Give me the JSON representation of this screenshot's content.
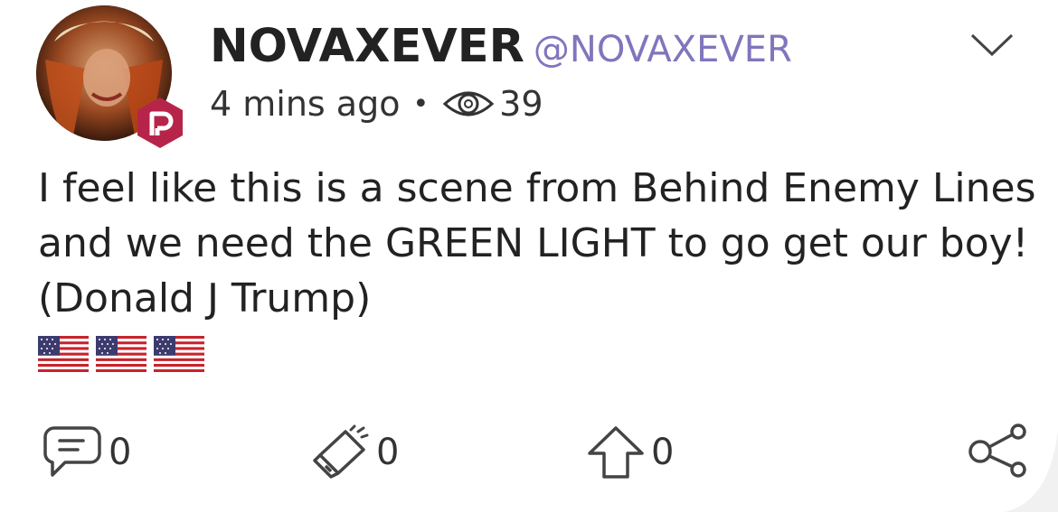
{
  "post": {
    "display_name": "NOVAXEVER",
    "handle": "@NOVAXEVER",
    "time_ago": "4 mins ago",
    "separator": "•",
    "views": "39",
    "text": "I feel like this is a scene from Behind Enemy Lines and we need the GREEN LIGHT to go get our boy! (Donald J Trump)",
    "emoji": [
      "us-flag",
      "us-flag",
      "us-flag"
    ]
  },
  "actions": {
    "comments": "0",
    "echoes": "0",
    "upvotes": "0"
  },
  "icons": {
    "badge": "parler-p-badge-icon",
    "options": "chevron-down-icon",
    "views": "eye-icon",
    "comment": "comment-icon",
    "echo": "megaphone-icon",
    "upvote": "upvote-arrow-icon",
    "share": "share-icon"
  },
  "colors": {
    "handle": "#7f76bd",
    "badge": "#b7244a",
    "text": "#222222"
  }
}
